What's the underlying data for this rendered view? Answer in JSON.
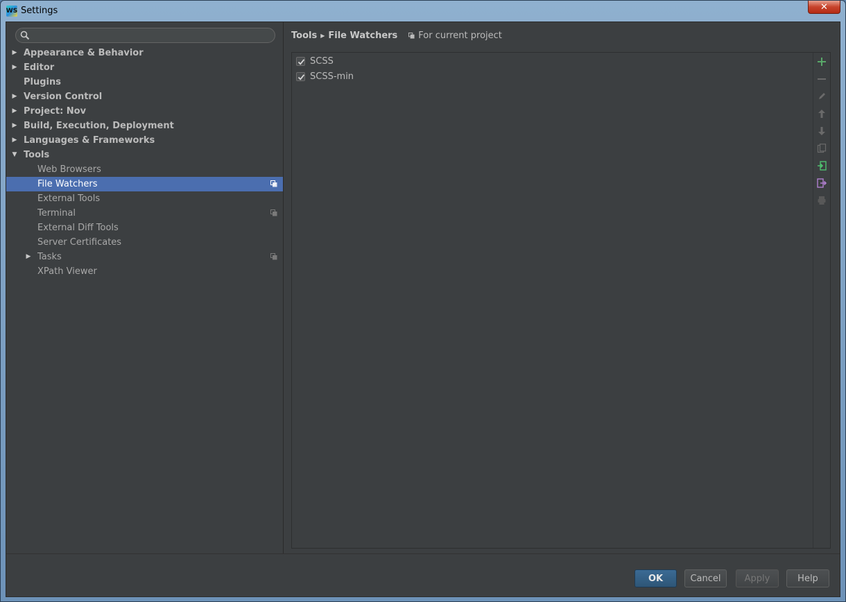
{
  "window": {
    "title": "Settings",
    "close_label": "✕"
  },
  "search": {
    "value": "",
    "placeholder": ""
  },
  "tree": {
    "items": [
      {
        "label": "Appearance & Behavior"
      },
      {
        "label": "Editor"
      },
      {
        "label": "Plugins"
      },
      {
        "label": "Version Control"
      },
      {
        "label": "Project: Nov"
      },
      {
        "label": "Build, Execution, Deployment"
      },
      {
        "label": "Languages & Frameworks"
      },
      {
        "label": "Tools"
      }
    ],
    "tools_children": [
      {
        "label": "Web Browsers"
      },
      {
        "label": "File Watchers"
      },
      {
        "label": "External Tools"
      },
      {
        "label": "Terminal"
      },
      {
        "label": "External Diff Tools"
      },
      {
        "label": "Server Certificates"
      },
      {
        "label": "Tasks"
      },
      {
        "label": "XPath Viewer"
      }
    ]
  },
  "breadcrumb": {
    "parent": "Tools",
    "current": "File Watchers",
    "scope": "For current project"
  },
  "watchers": [
    {
      "name": "SCSS",
      "checked": true
    },
    {
      "name": "SCSS-min",
      "checked": true
    }
  ],
  "toolbar_icons": [
    "add-icon",
    "remove-icon",
    "edit-icon",
    "move-up-icon",
    "move-down-icon",
    "copy-icon",
    "import-icon",
    "export-icon",
    "print-icon"
  ],
  "buttons": {
    "ok": "OK",
    "cancel": "Cancel",
    "apply": "Apply",
    "help": "Help"
  },
  "colors": {
    "background": "#3c3f41",
    "selection": "#4b6eaf",
    "add_green": "#59a869",
    "import_green": "#4fbf6f",
    "export_purple": "#b07fcf"
  }
}
